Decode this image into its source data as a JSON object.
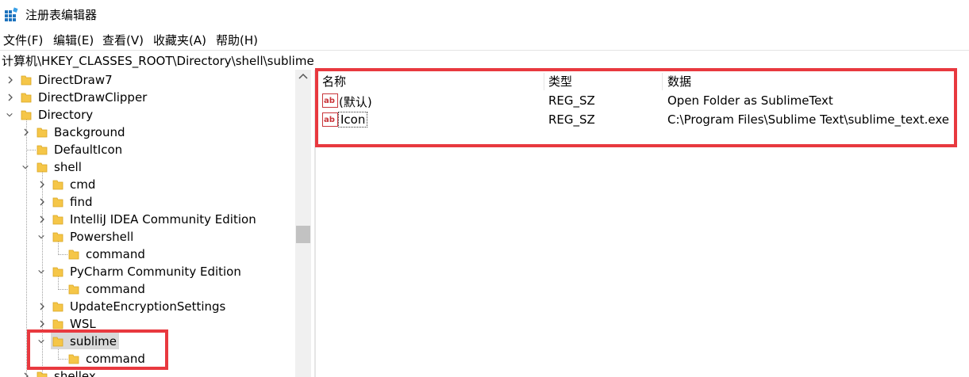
{
  "window": {
    "title": "注册表编辑器"
  },
  "menu": [
    "文件(F)",
    "编辑(E)",
    "查看(V)",
    "收藏夹(A)",
    "帮助(H)"
  ],
  "address": "计算机\\HKEY_CLASSES_ROOT\\Directory\\shell\\sublime",
  "tree": [
    {
      "label": "DirectDraw7"
    },
    {
      "label": "DirectDrawClipper"
    },
    {
      "label": "Directory"
    },
    {
      "label": "Background"
    },
    {
      "label": "DefaultIcon"
    },
    {
      "label": "shell"
    },
    {
      "label": "cmd"
    },
    {
      "label": "find"
    },
    {
      "label": "IntelliJ IDEA Community Edition"
    },
    {
      "label": "Powershell"
    },
    {
      "label": "command"
    },
    {
      "label": "PyCharm Community Edition"
    },
    {
      "label": "command"
    },
    {
      "label": "UpdateEncryptionSettings"
    },
    {
      "label": "WSL"
    },
    {
      "label": "sublime"
    },
    {
      "label": "command"
    },
    {
      "label": "shellex"
    }
  ],
  "list": {
    "columns": [
      "名称",
      "类型",
      "数据"
    ],
    "rows": [
      {
        "name": "(默认)",
        "type": "REG_SZ",
        "data": "Open Folder as SublimeText"
      },
      {
        "name": "Icon",
        "type": "REG_SZ",
        "data": "C:\\Program Files\\Sublime Text\\sublime_text.exe"
      }
    ]
  },
  "colors": {
    "highlight": "#e8393f",
    "folder": "#f5c648",
    "selection": "#d9d9d9"
  }
}
